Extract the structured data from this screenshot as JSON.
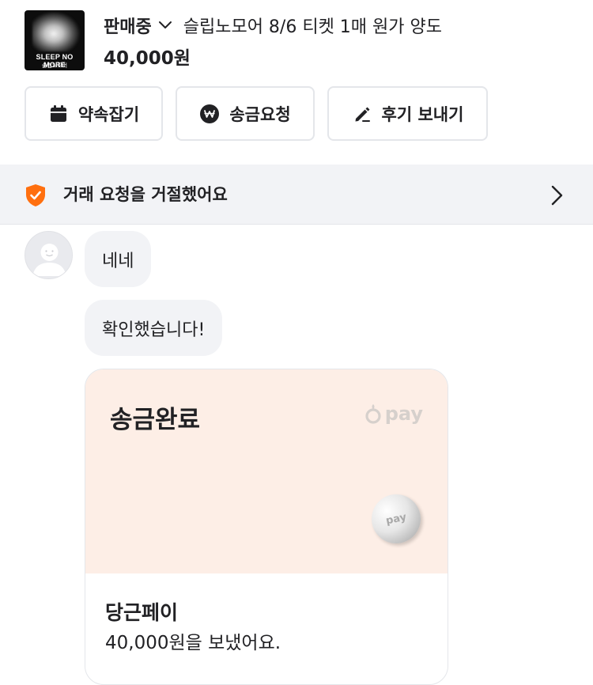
{
  "product": {
    "thumbnail_title": "SLEEP NO MORE",
    "thumbnail_subtitle": "슬립노모어",
    "status": "판매중",
    "title": "슬립노모어 8/6 티켓 1매 원가 양도",
    "price": "40,000원"
  },
  "actions": {
    "appointment_label": "약속잡기",
    "remit_request_label": "송금요청",
    "send_review_label": "후기 보내기"
  },
  "notice": {
    "text": "거래 요청을 거절했어요"
  },
  "messages": [
    {
      "text": "네네"
    },
    {
      "text": "확인했습니다!"
    }
  ],
  "remit_card": {
    "title": "송금완료",
    "brand_label": "pay",
    "coin_label": "pay",
    "sender": "당근페이",
    "message": "40,000원을 보냈어요."
  },
  "colors": {
    "accent_orange": "#ff6f0f",
    "notice_bg": "#f2f3f6",
    "bubble_bg": "#f2f3f6",
    "card_top_bg": "#fdeee6",
    "border": "#e4e6ea"
  }
}
